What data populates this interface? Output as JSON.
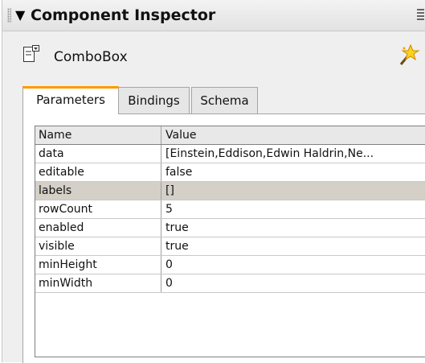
{
  "panel": {
    "title": "Component Inspector",
    "component_name": "ComboBox"
  },
  "tabs": [
    {
      "label": "Parameters",
      "active": true
    },
    {
      "label": "Bindings",
      "active": false
    },
    {
      "label": "Schema",
      "active": false
    }
  ],
  "grid": {
    "headers": {
      "name": "Name",
      "value": "Value"
    },
    "rows": [
      {
        "name": "data",
        "value": "[Einstein,Eddison,Edwin Haldrin,Ne..."
      },
      {
        "name": "editable",
        "value": "false"
      },
      {
        "name": "labels",
        "value": "[]",
        "selected": true
      },
      {
        "name": "rowCount",
        "value": "5"
      },
      {
        "name": "enabled",
        "value": "true"
      },
      {
        "name": "visible",
        "value": "true"
      },
      {
        "name": "minHeight",
        "value": "0"
      },
      {
        "name": "minWidth",
        "value": "0"
      }
    ]
  },
  "colors": {
    "tab_accent": "#ff9900",
    "selected_row": "#d4d0c8"
  }
}
